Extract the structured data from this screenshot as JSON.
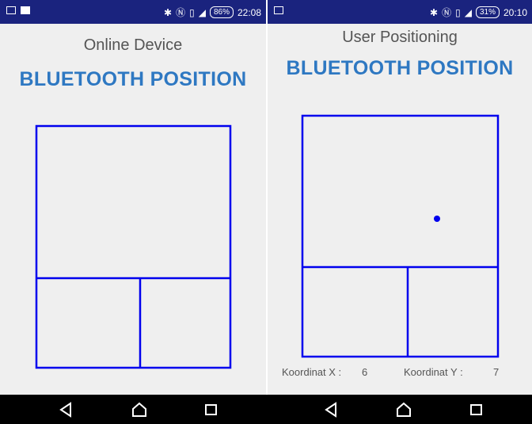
{
  "left_screen": {
    "status_bar": {
      "icons_left": [
        "gallery-icon",
        "cast-icon"
      ],
      "icons_right": [
        "bluetooth-icon",
        "nfc-icon",
        "vibrate-icon",
        "lte-signal-icon"
      ],
      "battery": "86%",
      "time": "22:08"
    },
    "subtitle": "Online Device",
    "title": "BLUETOOTH POSITION",
    "map": {
      "rooms": 3,
      "line_color": "#0000ee"
    }
  },
  "right_screen": {
    "status_bar": {
      "icons_left": [
        "gallery-icon"
      ],
      "icons_right": [
        "bluetooth-icon",
        "nfc-icon",
        "vibrate-icon",
        "lte-signal-icon"
      ],
      "battery": "31%",
      "time": "20:10"
    },
    "subtitle": "User Positioning",
    "title": "BLUETOOTH POSITION",
    "map": {
      "rooms": 3,
      "line_color": "#0000ee",
      "marker_color": "#0000ee"
    },
    "coordinates": {
      "x_label": "Koordinat X :",
      "x_value": "6",
      "y_label": "Koordinat Y :",
      "y_value": "7"
    }
  },
  "nav_bar": {
    "buttons": [
      "back-icon",
      "home-icon",
      "recents-icon"
    ]
  },
  "colors": {
    "status_bar": "#1a237e",
    "title": "#2e78c2",
    "map_lines": "#0000ee",
    "background": "#efefef"
  }
}
